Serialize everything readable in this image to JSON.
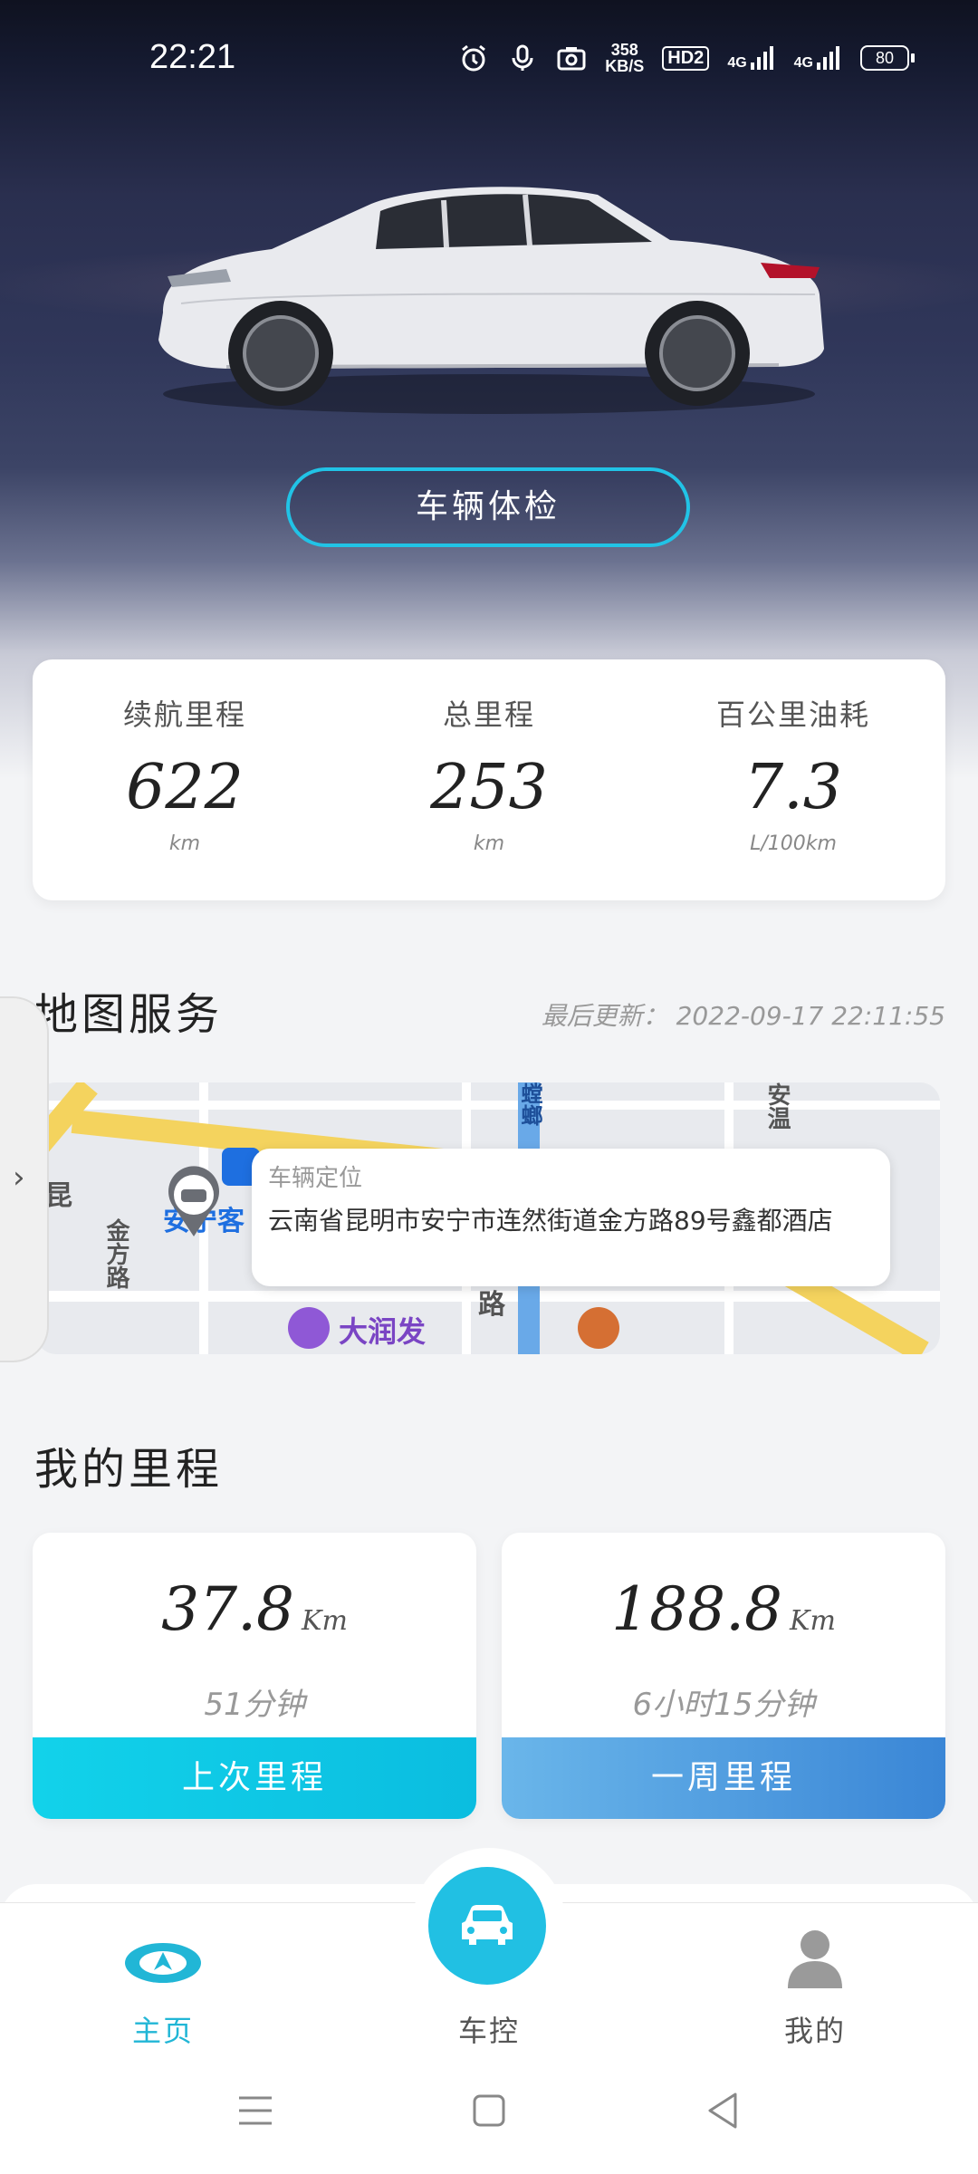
{
  "status_bar": {
    "time": "22:21",
    "net_speed_value": "358",
    "net_speed_unit": "KB/S",
    "hd_label": "HD2",
    "signal_1": "4G",
    "signal_2": "4G",
    "battery": "80"
  },
  "hero": {
    "check_button_label": "车辆体检"
  },
  "stats": [
    {
      "label": "续航里程",
      "value": "622",
      "unit": "km"
    },
    {
      "label": "总里程",
      "value": "253",
      "unit": "km"
    },
    {
      "label": "百公里油耗",
      "value": "7.3",
      "unit": "L/100km"
    }
  ],
  "map_service": {
    "title": "地图服务",
    "last_update": "最后更新： 2022-09-17 22:11:55",
    "popup_title": "车辆定位",
    "address": "云南省昆明市安宁市连然街道金方路89号鑫都酒店",
    "map_labels": {
      "anning": "安宁客",
      "jinfang": "金方路",
      "lu": "路",
      "kunming": "昆",
      "dalunfa": "大润发",
      "tanglang": "螳螂",
      "wenquan": "安温"
    }
  },
  "mileage": {
    "title": "我的里程",
    "cards": [
      {
        "value": "37.8",
        "unit": "Km",
        "duration": "51分钟",
        "footer": "上次里程",
        "color_start": "#12d2ea",
        "color_end": "#0bbde0"
      },
      {
        "value": "188.8",
        "unit": "Km",
        "duration": "6小时15分钟",
        "footer": "一周里程",
        "color_start": "#6ab6ea",
        "color_end": "#3a86d6"
      }
    ]
  },
  "tabs": [
    {
      "label": "主页",
      "icon": "brand-logo-icon",
      "active": true,
      "color": "#21b6d6"
    },
    {
      "label": "车控",
      "icon": "car-icon",
      "active": false
    },
    {
      "label": "我的",
      "icon": "person-icon",
      "active": false
    }
  ],
  "colors": {
    "accent": "#21c3e6"
  }
}
